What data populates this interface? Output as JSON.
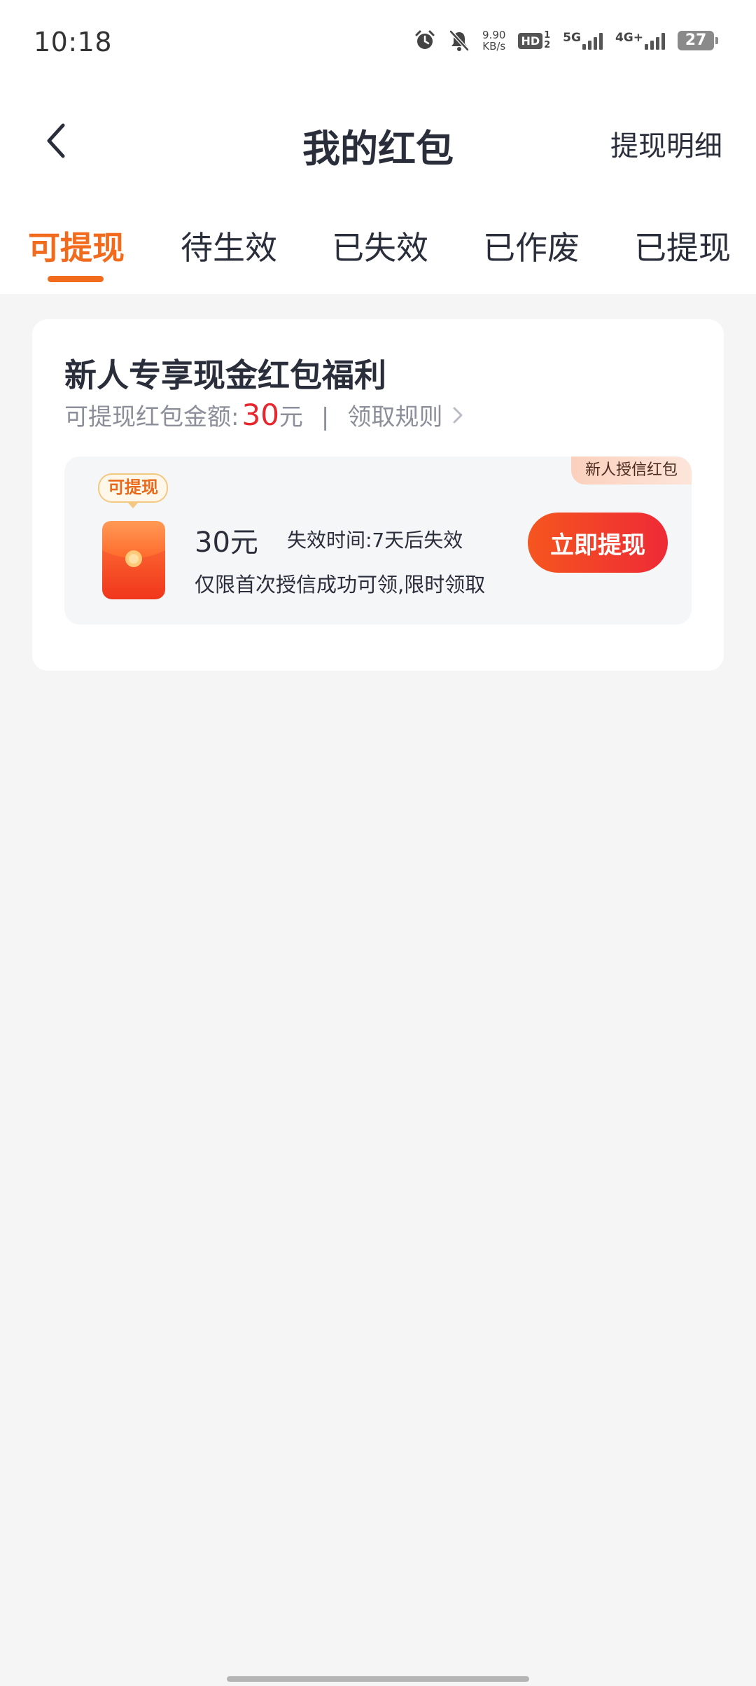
{
  "status_bar": {
    "time": "10:18",
    "net_speed_value": "9.90",
    "net_speed_unit": "KB/s",
    "hd_label": "HD",
    "hd_sub_top": "1",
    "hd_sub_bottom": "2",
    "sim1_label": "5G",
    "sim2_label": "4G+",
    "battery": "27",
    "icons": [
      "alarm-icon",
      "mute-bell-icon",
      "signal-icon",
      "battery-icon"
    ]
  },
  "header": {
    "title": "我的红包",
    "action": "提现明细",
    "back_icon": "chevron-left-icon"
  },
  "tabs": [
    {
      "label": "可提现",
      "active": true
    },
    {
      "label": "待生效",
      "active": false
    },
    {
      "label": "已失效",
      "active": false
    },
    {
      "label": "已作废",
      "active": false
    },
    {
      "label": "已提现",
      "active": false
    }
  ],
  "card": {
    "title": "新人专享现金红包福利",
    "amount_label": "可提现红包金额:",
    "amount_value": "30",
    "amount_unit": "元",
    "separator": "|",
    "rules_label": "领取规则",
    "coupon": {
      "corner_tag": "新人授信红包",
      "status_chip": "可提现",
      "amount": "30元",
      "expiry": "失效时间:7天后失效",
      "description": "仅限首次授信成功可领,限时领取",
      "button_label": "立即提现"
    }
  },
  "colors": {
    "accent_orange": "#f26b1d",
    "amount_red": "#e8262d",
    "button_start": "#f5561f",
    "button_end": "#ee2a36",
    "background": "#f5f5f5"
  }
}
